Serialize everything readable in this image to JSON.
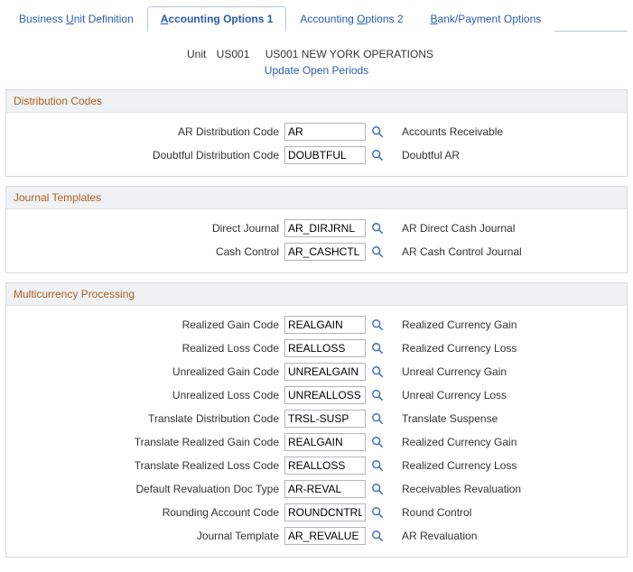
{
  "tabs": [
    {
      "prefix": "Business ",
      "ul": "U",
      "suffix": "nit Definition"
    },
    {
      "prefix": "",
      "ul": "A",
      "suffix": "ccounting Options 1"
    },
    {
      "prefix": "Accounting ",
      "ul": "O",
      "suffix": "ptions 2"
    },
    {
      "prefix": "",
      "ul": "B",
      "suffix": "ank/Payment Options"
    }
  ],
  "header": {
    "unit_label": "Unit",
    "unit_code": "US001",
    "unit_name": "US001 NEW YORK OPERATIONS",
    "update_link": "Update Open Periods"
  },
  "sections": {
    "dist": {
      "title": "Distribution Codes",
      "rows": [
        {
          "label": "AR Distribution Code",
          "value": "AR",
          "desc": "Accounts Receivable"
        },
        {
          "label": "Doubtful Distribution Code",
          "value": "DOUBTFUL",
          "desc": "Doubtful AR"
        }
      ]
    },
    "journal": {
      "title": "Journal Templates",
      "rows": [
        {
          "label": "Direct Journal",
          "value": "AR_DIRJRNL",
          "desc": "AR Direct Cash Journal"
        },
        {
          "label": "Cash Control",
          "value": "AR_CASHCTL",
          "desc": "AR Cash Control Journal"
        }
      ]
    },
    "multi": {
      "title": "Multicurrency Processing",
      "rows": [
        {
          "label": "Realized Gain Code",
          "value": "REALGAIN",
          "desc": "Realized Currency Gain"
        },
        {
          "label": "Realized Loss Code",
          "value": "REALLOSS",
          "desc": "Realized Currency Loss"
        },
        {
          "label": "Unrealized Gain Code",
          "value": "UNREALGAIN",
          "desc": "Unreal Currency Gain"
        },
        {
          "label": "Unrealized Loss Code",
          "value": "UNREALLOSS",
          "desc": "Unreal Currency Loss"
        },
        {
          "label": "Translate Distribution Code",
          "value": "TRSL-SUSP",
          "desc": "Translate Suspense"
        },
        {
          "label": "Translate Realized Gain Code",
          "value": "REALGAIN",
          "desc": "Realized Currency Gain"
        },
        {
          "label": "Translate Realized Loss Code",
          "value": "REALLOSS",
          "desc": "Realized Currency Loss"
        },
        {
          "label": "Default Revaluation Doc Type",
          "value": "AR-REVAL",
          "desc": "Receivables Revaluation"
        },
        {
          "label": "Rounding Account Code",
          "value": "ROUNDCNTRL",
          "desc": "Round Control"
        },
        {
          "label": "Journal Template",
          "value": "AR_REVALUE",
          "desc": "AR Revaluation"
        }
      ]
    }
  }
}
